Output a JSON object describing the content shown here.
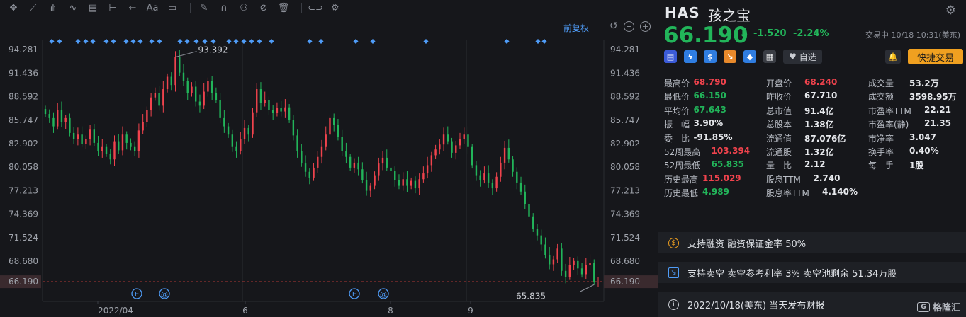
{
  "toolbar": {
    "icons": [
      "crosshair-icon",
      "trend-line-icon",
      "fork-icon",
      "wave-icon",
      "fib-icon",
      "measure-icon",
      "arrow-left-icon",
      "text-icon",
      "note-icon",
      "pen-icon",
      "magnet-icon",
      "lock-icon",
      "hide-icon",
      "trash-icon",
      "overlay-icon",
      "settings-icon"
    ],
    "text_tool_label": "Aa"
  },
  "chart": {
    "restore_label": "前复权",
    "price_ticks": [
      "94.281",
      "91.436",
      "88.592",
      "85.747",
      "82.902",
      "80.058",
      "77.213",
      "74.369",
      "71.524",
      "68.680"
    ],
    "current_price_label": "66.190",
    "high_annotation": "93.392",
    "low_annotation": "65.835",
    "x_labels": [
      "2022/04",
      "6",
      "8",
      "9"
    ],
    "event_marker_e": "E",
    "event_marker_at": "@",
    "colors": {
      "up": "#f0434d",
      "down": "#22b55a",
      "accent": "#4f9cf7",
      "price_line": "#e0433f"
    }
  },
  "chart_data": {
    "type": "candlestick",
    "ylim": [
      65.0,
      95.5
    ],
    "y_ticks": [
      94.281,
      91.436,
      88.592,
      85.747,
      82.902,
      80.058,
      77.213,
      74.369,
      71.524,
      68.68
    ],
    "current_price": 66.19,
    "high_marker": 93.392,
    "low_marker": 65.835,
    "x_tick_labels": [
      "2022/04",
      "6",
      "8",
      "9"
    ],
    "candles": []
  },
  "quote": {
    "symbol": "HAS",
    "name": "孩之宝",
    "price": "66.190",
    "change": "-1.520",
    "change_pct": "-2.24%",
    "status": "交易中 10/18 10:31(美东)",
    "fav_label": "自选",
    "trade_label": "快捷交易"
  },
  "stats": [
    [
      [
        "最高价",
        "68.790",
        "red"
      ],
      [
        "开盘价",
        "68.240",
        "red"
      ],
      [
        "成交量",
        "53.2万",
        ""
      ]
    ],
    [
      [
        "最低价",
        "66.150",
        "green"
      ],
      [
        "昨收价",
        "67.710",
        ""
      ],
      [
        "成交额",
        "3598.95万",
        ""
      ]
    ],
    [
      [
        "平均价",
        "67.643",
        "green"
      ],
      [
        "总市值",
        "91.4亿",
        ""
      ],
      [
        "市盈率TTM",
        "22.21",
        ""
      ]
    ],
    [
      [
        "振　幅",
        "3.90%",
        ""
      ],
      [
        "总股本",
        "1.38亿",
        ""
      ],
      [
        "市盈率(静)",
        "21.35",
        ""
      ]
    ],
    [
      [
        "委　比",
        "-91.85%",
        ""
      ],
      [
        "流通值",
        "87.076亿",
        ""
      ],
      [
        "市净率",
        "3.047",
        ""
      ]
    ],
    [
      [
        "52周最高",
        "103.394",
        "red"
      ],
      [
        "流通股",
        "1.32亿",
        ""
      ],
      [
        "换手率",
        "0.40%",
        ""
      ]
    ],
    [
      [
        "52周最低",
        "65.835",
        "green"
      ],
      [
        "量　比",
        "2.12",
        ""
      ],
      [
        "每　手",
        "1股",
        ""
      ]
    ],
    [
      [
        "历史最高",
        "115.029",
        "red"
      ],
      [
        "股息TTM",
        "2.740",
        ""
      ],
      [
        "",
        "",
        ""
      ]
    ],
    [
      [
        "历史最低",
        "4.989",
        "green"
      ],
      [
        "股息率TTM",
        "4.140%",
        ""
      ],
      [
        "",
        "",
        ""
      ]
    ]
  ],
  "info": {
    "margin": "支持融资 融资保证金率 50%",
    "short": "支持卖空 卖空参考利率 3% 卖空池剩余 51.34万股",
    "earnings": "2022/10/18(美东) 当天发布财报"
  },
  "watermark": "格隆汇"
}
